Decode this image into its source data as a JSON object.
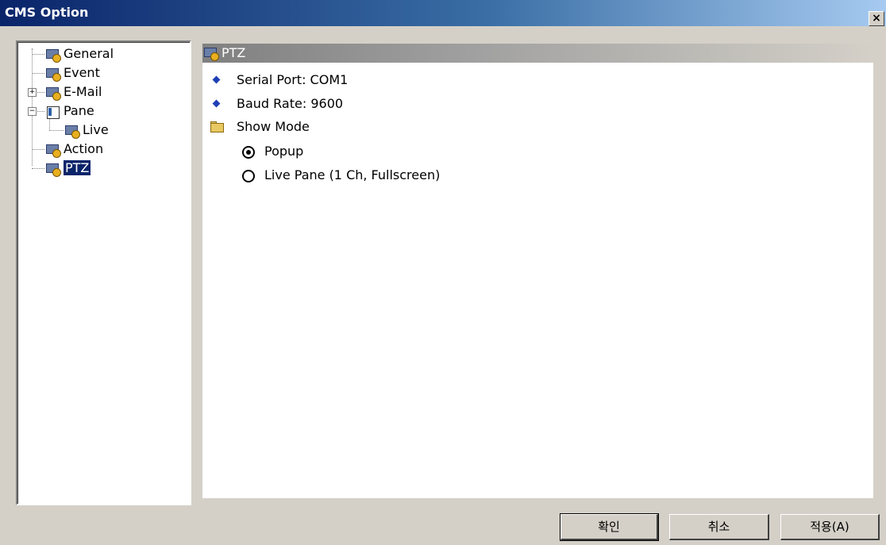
{
  "window": {
    "title": "CMS Option",
    "close_glyph": "×"
  },
  "tree": {
    "items": [
      {
        "label": "General",
        "icon": "settings-icon"
      },
      {
        "label": "Event",
        "icon": "settings-icon"
      },
      {
        "label": "E-Mail",
        "icon": "settings-icon",
        "expander": "+"
      },
      {
        "label": "Pane",
        "icon": "pane-icon",
        "expander": "−"
      },
      {
        "label": "Live",
        "icon": "settings-icon"
      },
      {
        "label": "Action",
        "icon": "settings-icon"
      },
      {
        "label": "PTZ",
        "icon": "settings-icon",
        "selected": true
      }
    ]
  },
  "panel": {
    "header": "PTZ",
    "serial_port": "Serial Port: COM1",
    "baud_rate": "Baud Rate: 9600",
    "show_mode": "Show Mode",
    "options": [
      {
        "label": "Popup",
        "selected": true
      },
      {
        "label": "Live Pane (1 Ch, Fullscreen)",
        "selected": false
      }
    ]
  },
  "buttons": {
    "ok": "확인",
    "cancel": "취소",
    "apply": "적용(A)"
  }
}
